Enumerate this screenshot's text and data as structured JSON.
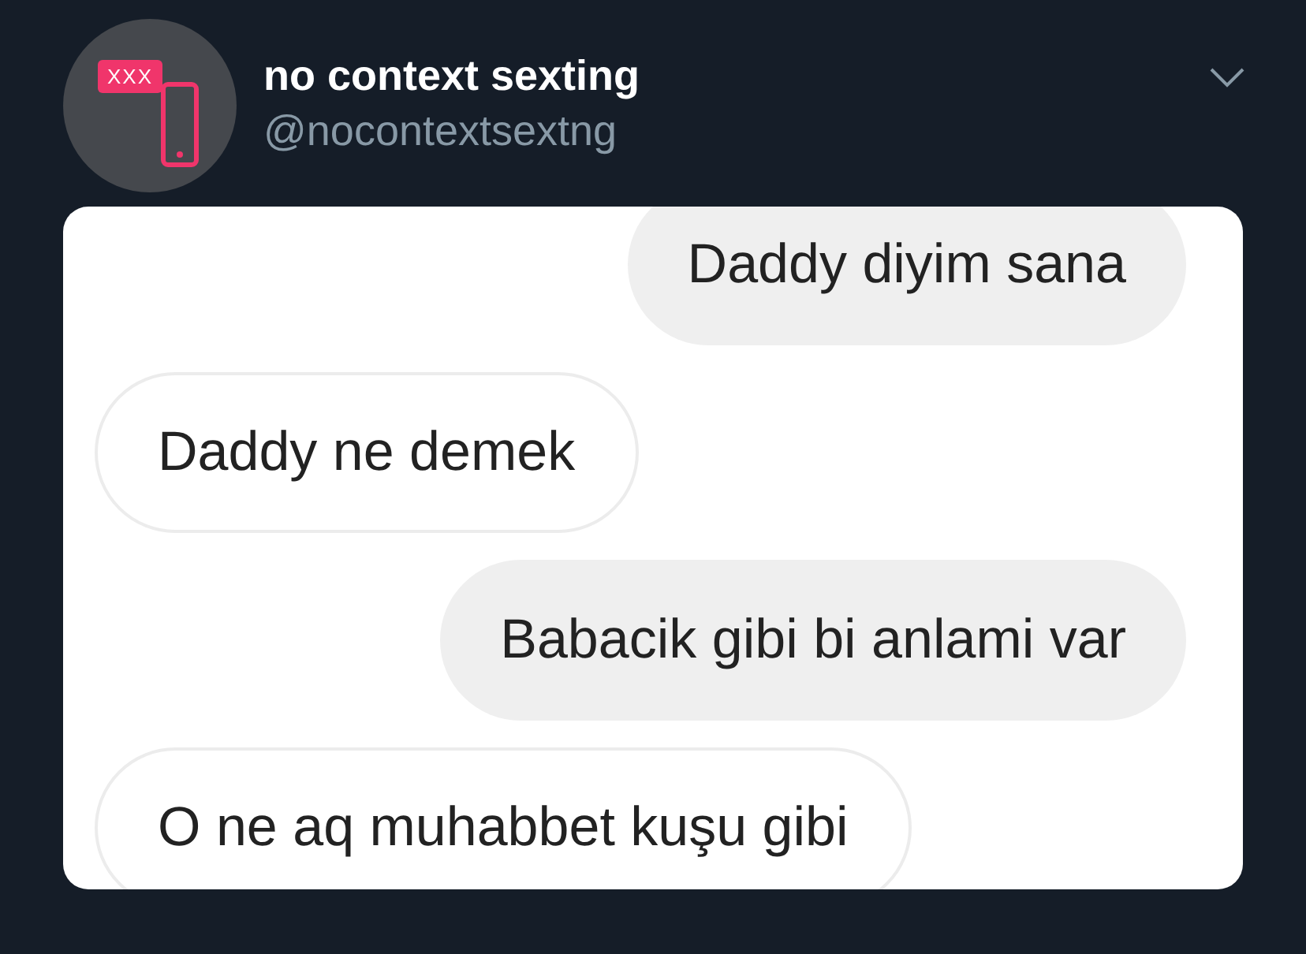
{
  "account": {
    "avatar_label": "XXX",
    "name": "no context sexting",
    "handle": "@nocontextsextng"
  },
  "messages": [
    {
      "kind": "sent",
      "text": "Daddy diyim sana"
    },
    {
      "kind": "received",
      "text": "Daddy ne demek"
    },
    {
      "kind": "sent",
      "text": "Babacik gibi bi anlami var"
    },
    {
      "kind": "received",
      "text": "O ne aq muhabbet kuşu gibi"
    }
  ]
}
